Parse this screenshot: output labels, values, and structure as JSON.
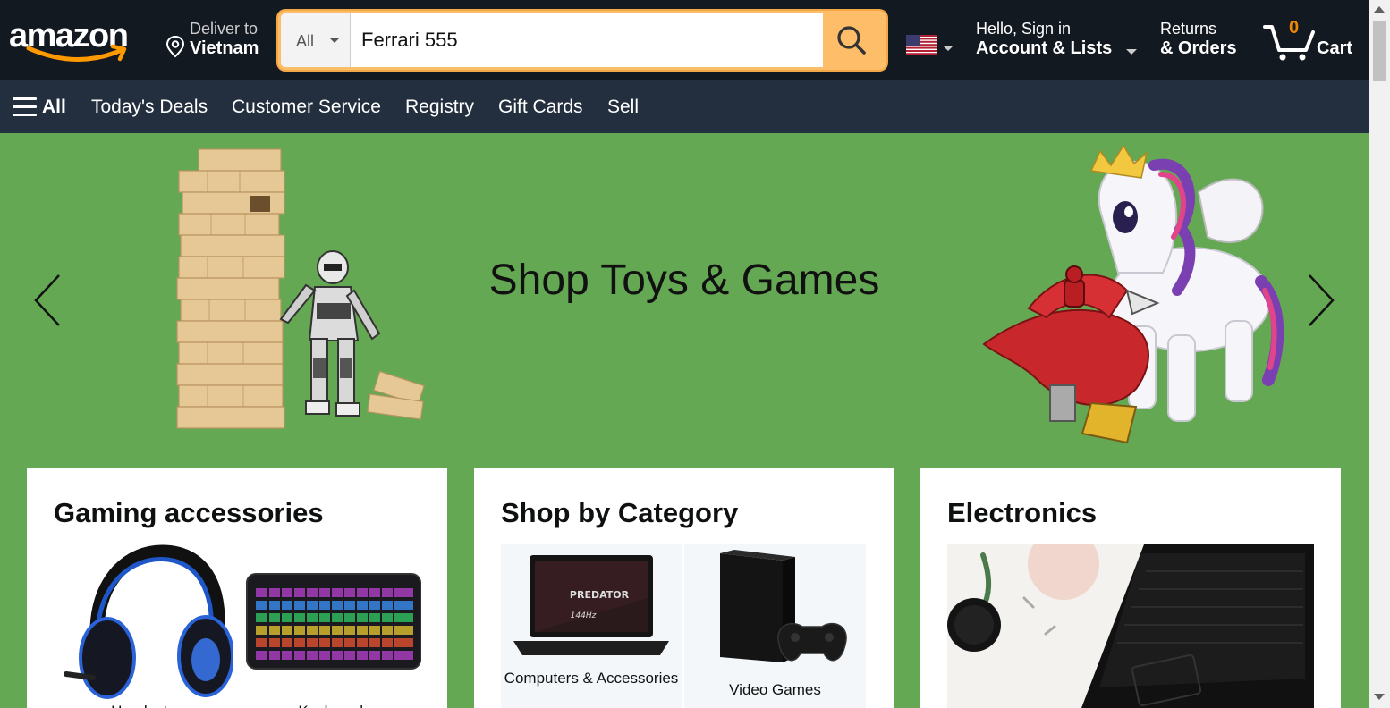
{
  "header": {
    "logo_text": "amazon",
    "deliver_line1": "Deliver to",
    "deliver_line2": "Vietnam",
    "search_category": "All",
    "search_value": "Ferrari 555",
    "account_line1": "Hello, Sign in",
    "account_line2": "Account & Lists",
    "returns_line1": "Returns",
    "returns_line2": "& Orders",
    "cart_count": "0",
    "cart_label": "Cart"
  },
  "nav": {
    "all_label": "All",
    "links": [
      "Today's Deals",
      "Customer Service",
      "Registry",
      "Gift Cards",
      "Sell"
    ]
  },
  "hero": {
    "title": "Shop Toys & Games"
  },
  "cards": [
    {
      "title": "Gaming accessories",
      "tiles": [
        "Headsets",
        "Keyboards"
      ]
    },
    {
      "title": "Shop by Category",
      "tiles": [
        "Computers & Accessories",
        "Video Games"
      ],
      "laptop_brand": "PREDATOR",
      "laptop_sub": "144Hz"
    },
    {
      "title": "Electronics"
    }
  ],
  "colors": {
    "header_bg": "#131921",
    "subnav_bg": "#232f3e",
    "accent": "#febd69",
    "cart_count": "#f08804",
    "hero_bg": "#65a853"
  },
  "icons": [
    "location-pin-icon",
    "search-icon",
    "us-flag-icon",
    "cart-icon",
    "hamburger-icon",
    "chevron-left-icon",
    "chevron-right-icon"
  ]
}
